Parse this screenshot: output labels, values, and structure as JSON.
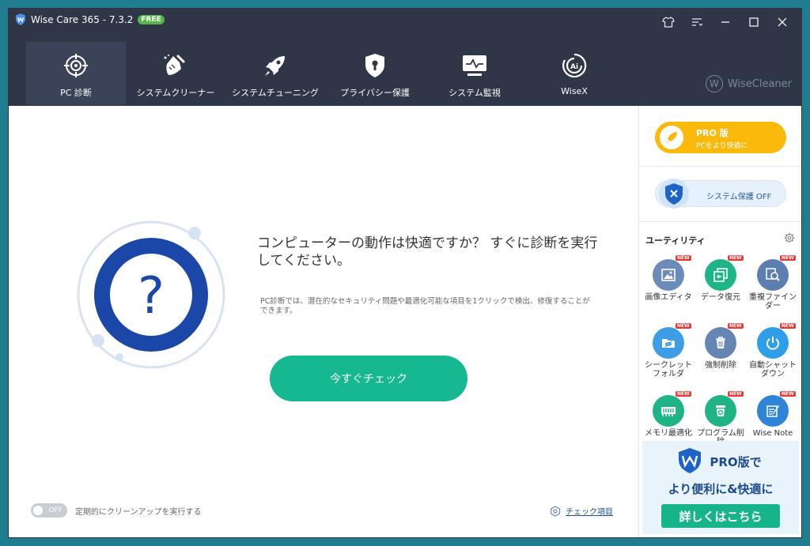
{
  "window": {
    "title": "Wise Care 365 - 7.3.2",
    "badge": "FREE"
  },
  "nav": {
    "items": [
      {
        "label": "PC 診断",
        "icon": "target-icon"
      },
      {
        "label": "システムクリーナー",
        "icon": "broom-icon"
      },
      {
        "label": "システムチューニング",
        "icon": "rocket-icon"
      },
      {
        "label": "プライバシー保護",
        "icon": "shield-lock-icon"
      },
      {
        "label": "システム監視",
        "icon": "monitor-icon"
      },
      {
        "label": "WiseX",
        "icon": "wisex-ai-icon"
      }
    ],
    "brand": "WiseCleaner",
    "brand_letter": "W"
  },
  "main": {
    "headline": "コンピューターの動作は快適ですか？ すぐに診断を実行してください。",
    "question_mark": "?",
    "description": "PC診断では、潜在的なセキュリティ問題や最適化可能な項目を1クリックで検出、修復することができます。",
    "check_button": "今すぐチェック",
    "toggle_state": "OFF",
    "toggle_label": "定期的にクリーンアップを実行する",
    "check_items_link": "チェック項目"
  },
  "sidebar": {
    "pro_title": "PRO 版",
    "pro_subtitle": "PCをより快適に",
    "protect_label": "システム保護 OFF",
    "utilities_title": "ユーティリティ",
    "new_badge": "NEW",
    "utilities": [
      {
        "label": "画像エディタ",
        "color": "#6b8bb8",
        "icon": "image-icon"
      },
      {
        "label": "データ復元",
        "color": "#1fb486",
        "icon": "restore-icon"
      },
      {
        "label": "重複ファインダー",
        "color": "#5c7fb0",
        "icon": "search-duplicate-icon"
      },
      {
        "label": "シークレットフォルダ",
        "color": "#3d9de6",
        "icon": "hidden-folder-icon"
      },
      {
        "label": "強制削除",
        "color": "#6585b3",
        "icon": "trash-icon"
      },
      {
        "label": "自動シャットダウン",
        "color": "#2f9ee8",
        "icon": "power-icon"
      },
      {
        "label": "メモリ最適化",
        "color": "#1fb486",
        "icon": "memory-icon"
      },
      {
        "label": "プログラム削除",
        "color": "#1fb486",
        "icon": "uninstall-icon"
      },
      {
        "label": "Wise Note",
        "color": "#2f84d8",
        "icon": "note-icon"
      }
    ],
    "banner_line1": "PRO版で",
    "banner_line2": "より便利に&快適に",
    "banner_button": "詳しくはこちら"
  }
}
